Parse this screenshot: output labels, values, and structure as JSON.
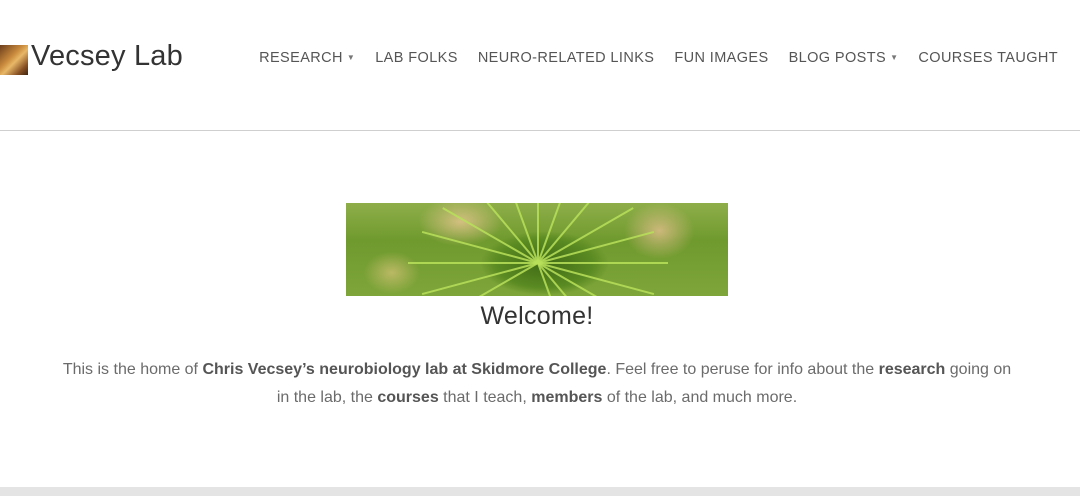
{
  "site": {
    "title": "Vecsey Lab"
  },
  "nav": {
    "items": [
      {
        "label": "RESEARCH",
        "dropdown": true
      },
      {
        "label": "LAB FOLKS",
        "dropdown": false
      },
      {
        "label": "NEURO-RELATED LINKS",
        "dropdown": false
      },
      {
        "label": "FUN IMAGES",
        "dropdown": false
      },
      {
        "label": "BLOG POSTS",
        "dropdown": true
      },
      {
        "label": "COURSES TAUGHT",
        "dropdown": false
      }
    ]
  },
  "main": {
    "heading": "Welcome!",
    "intro": {
      "t1": "This is the home of ",
      "b1": "Chris Vecsey’s neurobiology lab at Skidmore College",
      "t2": ". Feel free to peruse for info about the ",
      "b2": "research",
      "t3": " going on in the lab, the ",
      "b3": "courses",
      "t4": " that I teach, ",
      "b4": "members",
      "t5": " of the lab, and much more."
    }
  },
  "colors": {
    "text": "#6b6b6b",
    "heading": "#333333",
    "divider": "#cfcfcf"
  }
}
